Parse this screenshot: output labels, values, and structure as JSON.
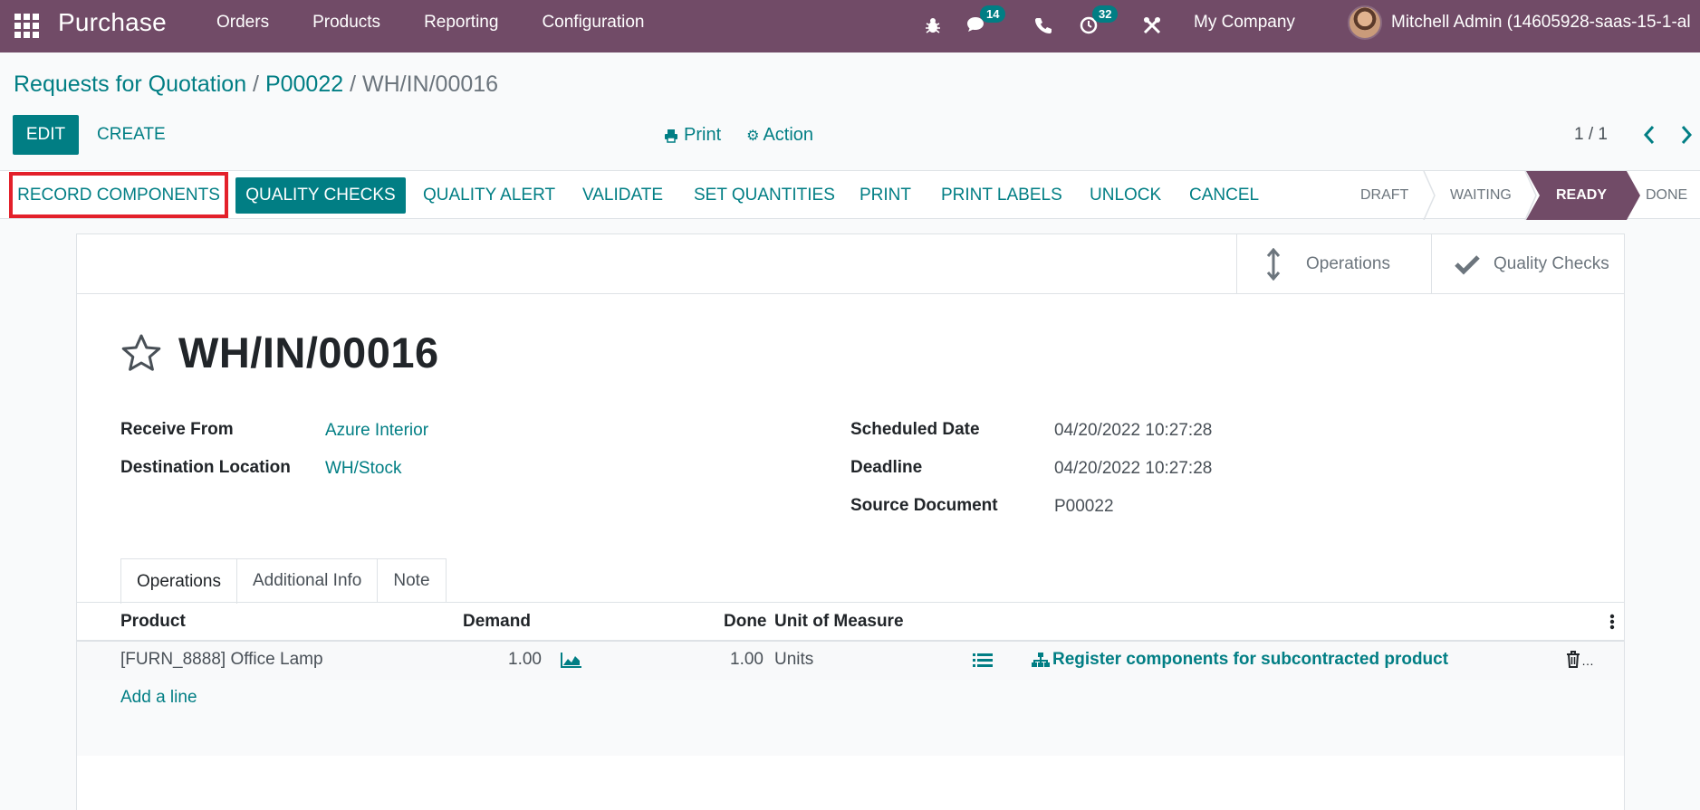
{
  "topnav": {
    "app_title": "Purchase",
    "menu": [
      "Orders",
      "Products",
      "Reporting",
      "Configuration"
    ],
    "chat_badge": "14",
    "activity_badge": "32",
    "company": "My Company",
    "user": "Mitchell Admin (14605928-saas-15-1-al"
  },
  "control": {
    "breadcrumb_1": "Requests for Quotation",
    "breadcrumb_2": "P00022",
    "breadcrumb_3": "WH/IN/00016",
    "sep": "/",
    "edit": "EDIT",
    "create": "CREATE",
    "print": "Print",
    "action": "Action",
    "pager": "1 / 1"
  },
  "statusbar": {
    "buttons": [
      "RECORD COMPONENTS",
      "QUALITY CHECKS",
      "QUALITY ALERT",
      "VALIDATE",
      "SET QUANTITIES",
      "PRINT",
      "PRINT LABELS",
      "UNLOCK",
      "CANCEL"
    ],
    "stages": [
      "DRAFT",
      "WAITING",
      "READY",
      "DONE"
    ],
    "active_stage": "READY"
  },
  "smart_buttons": {
    "operations": "Operations",
    "quality_checks": "Quality Checks"
  },
  "record": {
    "name": "WH/IN/00016",
    "receive_from_label": "Receive From",
    "receive_from": "Azure Interior",
    "destination_label": "Destination Location",
    "destination": "WH/Stock",
    "scheduled_label": "Scheduled Date",
    "scheduled": "04/20/2022 10:27:28",
    "deadline_label": "Deadline",
    "deadline": "04/20/2022 10:27:28",
    "source_label": "Source Document",
    "source": "P00022"
  },
  "tabs": [
    "Operations",
    "Additional Info",
    "Note"
  ],
  "table": {
    "headers": [
      "Product",
      "Demand",
      "Done",
      "Unit of Measure"
    ],
    "rows": [
      {
        "product": "[FURN_8888] Office Lamp",
        "demand": "1.00",
        "done": "1.00",
        "uom": "Units",
        "action": "Register components for subcontracted product"
      }
    ],
    "add_line": "Add a line"
  },
  "colors": {
    "brand": "#714b67",
    "accent": "#017e84",
    "highlight": "#e3202a"
  }
}
